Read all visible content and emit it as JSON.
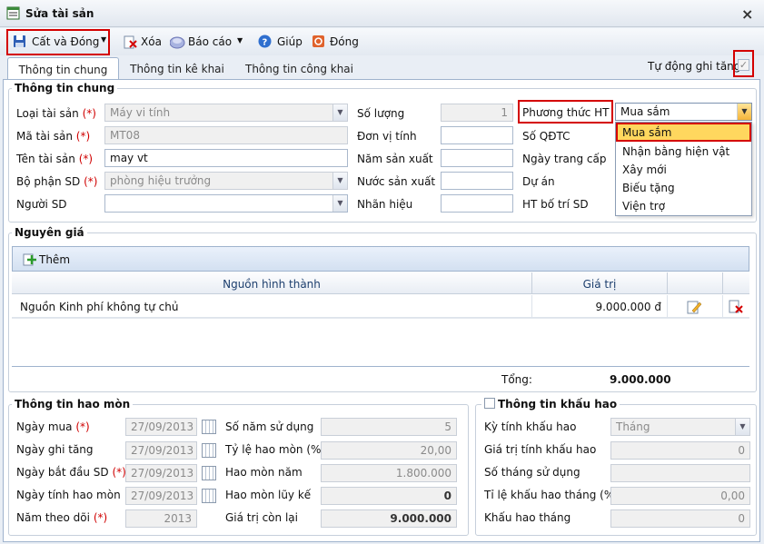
{
  "window": {
    "title": "Sửa tài sản",
    "close": "×"
  },
  "toolbar": {
    "save_close": "Cất và Đóng",
    "delete": "Xóa",
    "report": "Báo cáo",
    "help": "Giúp",
    "close": "Đóng"
  },
  "tabs": [
    "Thông tin chung",
    "Thông tin kê khai",
    "Thông tin công khai"
  ],
  "auto_increase": {
    "label": "Tự động ghi tăng",
    "checked": true
  },
  "general": {
    "title": "Thông tin chung",
    "asset_type": {
      "label": "Loại tài sản",
      "req": "(*)",
      "value": "Máy vi tính"
    },
    "asset_code": {
      "label": "Mã tài sản",
      "req": "(*)",
      "value": "MT08"
    },
    "asset_name": {
      "label": "Tên tài sản",
      "req": "(*)",
      "value": "may vt"
    },
    "dept": {
      "label": "Bộ phận SD",
      "req": "(*)",
      "value": "phòng hiệu trưởng"
    },
    "user": {
      "label": "Người SD",
      "value": ""
    },
    "quantity": {
      "label": "Số lượng",
      "value": "1"
    },
    "unit": {
      "label": "Đơn vị tính",
      "value": ""
    },
    "year_made": {
      "label": "Năm sản xuất",
      "value": ""
    },
    "country": {
      "label": "Nước sản xuất",
      "value": ""
    },
    "brand": {
      "label": "Nhãn hiệu",
      "value": ""
    },
    "method": {
      "label": "Phương thức HT",
      "value": "Mua sắm"
    },
    "qdtc": {
      "label": "Số QĐTC"
    },
    "equip_date": {
      "label": "Ngày trang cấp"
    },
    "project": {
      "label": "Dự án"
    },
    "ht": {
      "label": "HT bố trí SD"
    },
    "method_options": [
      "Mua sắm",
      "Nhận bằng hiện vật",
      "Xây mới",
      "Biếu tặng",
      "Viện trợ"
    ]
  },
  "origin": {
    "title": "Nguyên giá",
    "add": "Thêm",
    "columns": [
      "Nguồn hình thành",
      "Giá trị"
    ],
    "rows": [
      {
        "source": "Nguồn Kinh phí không tự chủ",
        "value": "9.000.000 đ"
      }
    ],
    "total_label": "Tổng:",
    "total": "9.000.000"
  },
  "depreciation": {
    "title": "Thông tin hao mòn",
    "buy_date": {
      "label": "Ngày mua",
      "req": "(*)",
      "value": "27/09/2013"
    },
    "inc_date": {
      "label": "Ngày ghi tăng",
      "value": "27/09/2013"
    },
    "start_date": {
      "label": "Ngày bắt đầu SD",
      "req": "(*)",
      "value": "27/09/2013"
    },
    "calc_date": {
      "label": "Ngày tính hao mòn",
      "value": "27/09/2013"
    },
    "track_year": {
      "label": "Năm theo dõi",
      "req": "(*)",
      "value": "2013"
    },
    "years": {
      "label": "Số năm sử dụng",
      "value": "5"
    },
    "rate": {
      "label": "Tỷ lệ hao mòn (%)",
      "value": "20,00"
    },
    "annual": {
      "label": "Hao mòn năm",
      "value": "1.800.000"
    },
    "accum": {
      "label": "Hao mòn lũy kế",
      "value": "0"
    },
    "remaining": {
      "label": "Giá trị còn lại",
      "value": "9.000.000"
    }
  },
  "amortization": {
    "title": "Thông tin khấu hao",
    "period": {
      "label": "Kỳ tính khấu hao",
      "value": "Tháng"
    },
    "base": {
      "label": "Giá trị tính khấu hao",
      "value": "0"
    },
    "months": {
      "label": "Số tháng sử dụng",
      "value": ""
    },
    "rate": {
      "label": "Tỉ lệ khấu hao tháng (%)",
      "value": "0,00"
    },
    "monthly": {
      "label": "Khấu hao tháng",
      "value": "0"
    }
  },
  "colors": {
    "accent": "#1d4d8d",
    "highlight": "#ffd75e",
    "required": "#d00000",
    "callout": "#d40000"
  }
}
